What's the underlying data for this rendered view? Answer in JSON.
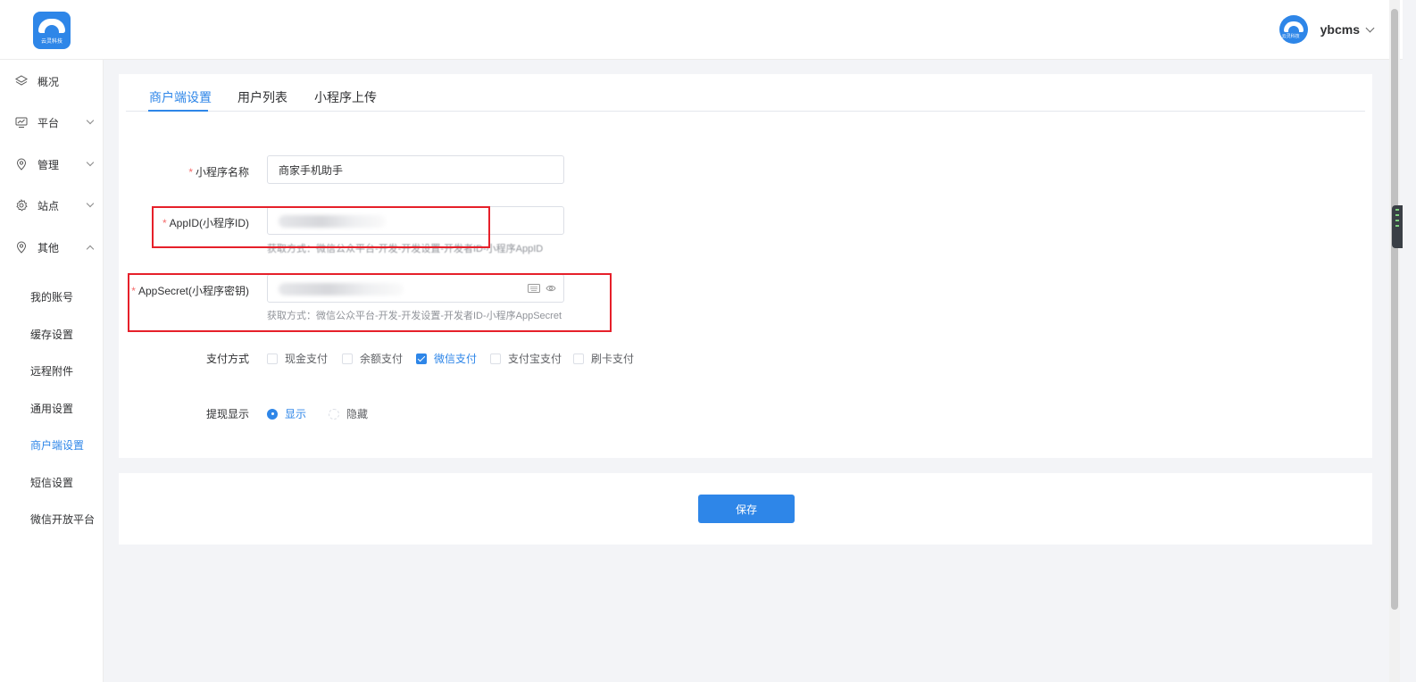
{
  "header": {
    "logo_text": "云灵科技",
    "username": "ybcms"
  },
  "sidebar": {
    "items": [
      {
        "label": "概况",
        "icon": "layers-icon"
      },
      {
        "label": "平台",
        "icon": "monitor-icon",
        "expandable": true
      },
      {
        "label": "管理",
        "icon": "location-icon",
        "expandable": true
      },
      {
        "label": "站点",
        "icon": "gear-icon",
        "expandable": true
      },
      {
        "label": "其他",
        "icon": "location-icon",
        "expandable": true,
        "expanded": true
      }
    ],
    "subitems": [
      {
        "label": "我的账号"
      },
      {
        "label": "缓存设置"
      },
      {
        "label": "远程附件"
      },
      {
        "label": "通用设置"
      },
      {
        "label": "商户端设置",
        "active": true
      },
      {
        "label": "短信设置"
      },
      {
        "label": "微信开放平台"
      }
    ]
  },
  "tabs": [
    {
      "label": "商户端设置",
      "active": true
    },
    {
      "label": "用户列表"
    },
    {
      "label": "小程序上传"
    }
  ],
  "form": {
    "app_name": {
      "label": "小程序名称",
      "value": "商家手机助手"
    },
    "app_id": {
      "label": "AppID(小程序ID)",
      "hint": "获取方式：微信公众平台-开发-开发设置-开发者ID-小程序AppID"
    },
    "app_secret": {
      "label": "AppSecret(小程序密钥)",
      "hint": "获取方式：微信公众平台-开发-开发设置-开发者ID-小程序AppSecret"
    },
    "payment": {
      "label": "支付方式",
      "options": [
        {
          "label": "现金支付",
          "checked": false
        },
        {
          "label": "余额支付",
          "checked": false
        },
        {
          "label": "微信支付",
          "checked": true
        },
        {
          "label": "支付宝支付",
          "checked": false
        },
        {
          "label": "刷卡支付",
          "checked": false
        }
      ]
    },
    "withdraw": {
      "label": "提现显示",
      "options": [
        {
          "label": "显示",
          "selected": true
        },
        {
          "label": "隐藏",
          "selected": false
        }
      ]
    },
    "save_label": "保存"
  },
  "colors": {
    "accent": "#2e86e8",
    "required": "#f56c6c",
    "highlight_box": "#e6202a"
  }
}
